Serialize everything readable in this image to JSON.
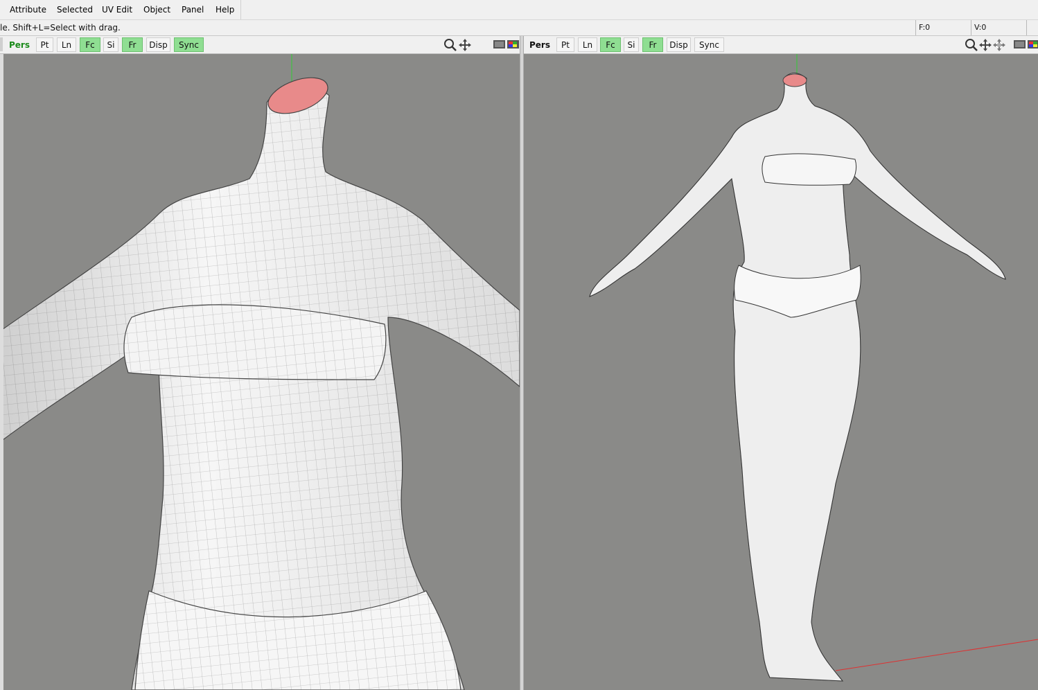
{
  "menubar": {
    "items": [
      "Attribute",
      "Selected",
      "UV Edit",
      "Object",
      "Panel",
      "Help"
    ]
  },
  "status": {
    "hint": "le.  Shift+L=Select with drag.",
    "faces": "F:0",
    "vertices": "V:0"
  },
  "left_view": {
    "mode": "Pers",
    "buttons": [
      {
        "label": "Pt",
        "active": false
      },
      {
        "label": "Ln",
        "active": false
      },
      {
        "label": "Fc",
        "active": true
      },
      {
        "label": "Si",
        "active": false
      },
      {
        "label": "Fr",
        "active": true
      },
      {
        "label": "Disp",
        "active": false
      },
      {
        "label": "Sync",
        "active": true
      }
    ]
  },
  "right_view": {
    "mode": "Pers",
    "buttons": [
      {
        "label": "Pt",
        "active": false
      },
      {
        "label": "Ln",
        "active": false
      },
      {
        "label": "Fc",
        "active": true
      },
      {
        "label": "Si",
        "active": false
      },
      {
        "label": "Fr",
        "active": true
      },
      {
        "label": "Disp",
        "active": false
      },
      {
        "label": "Sync",
        "active": false
      }
    ]
  },
  "colors": {
    "viewport_bg": "#8a8a88",
    "active_toggle": "#8fde92",
    "mesh": "#f2f2f2",
    "selected_face": "#e88a8a",
    "axis_y": "#33cc33",
    "axis_x": "#e03030"
  }
}
